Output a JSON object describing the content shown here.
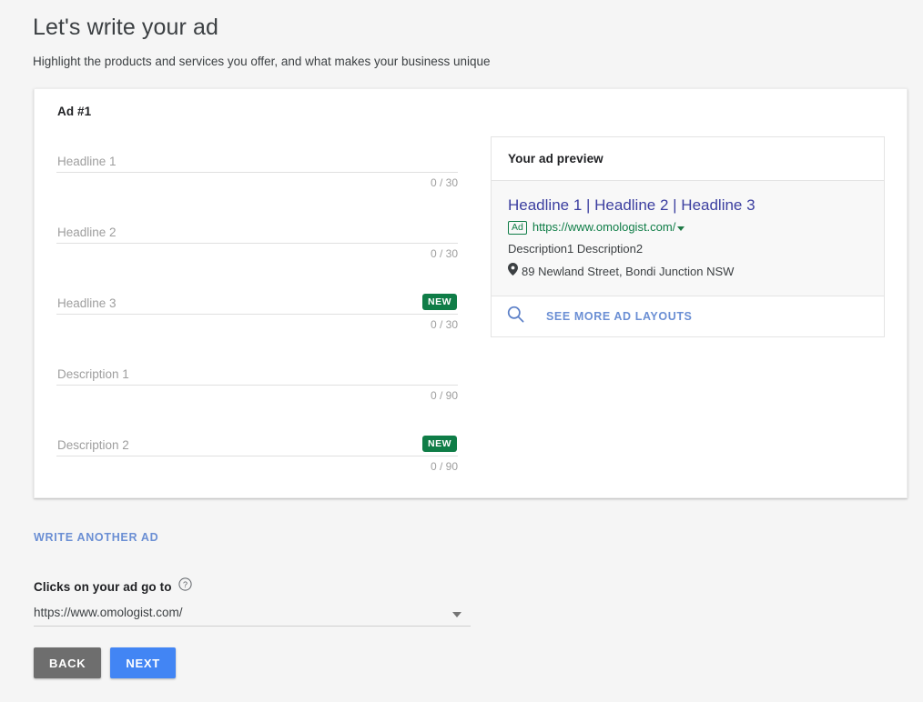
{
  "page": {
    "title": "Let's write your ad",
    "subtitle": "Highlight the products and services you offer, and what makes your business unique"
  },
  "ad_card": {
    "title": "Ad #1",
    "fields": [
      {
        "label": "Headline 1",
        "counter": "0 / 30",
        "badge": ""
      },
      {
        "label": "Headline 2",
        "counter": "0 / 30",
        "badge": ""
      },
      {
        "label": "Headline 3",
        "counter": "0 / 30",
        "badge": "NEW"
      },
      {
        "label": "Description 1",
        "counter": "0 / 90",
        "badge": ""
      },
      {
        "label": "Description 2",
        "counter": "0 / 90",
        "badge": "NEW"
      }
    ]
  },
  "preview": {
    "header_title": "Your ad preview",
    "headline": "Headline 1 | Headline 2 | Headline 3",
    "ad_chip": "Ad",
    "url": "https://www.omologist.com/",
    "description": "Description1 Description2",
    "location": "89 Newland Street, Bondi Junction NSW",
    "see_more_label": "SEE MORE AD LAYOUTS"
  },
  "actions": {
    "write_another_ad": "WRITE ANOTHER AD",
    "clicks_label": "Clicks on your ad go to",
    "final_url_value": "https://www.omologist.com/",
    "back_label": "BACK",
    "next_label": "NEXT"
  },
  "colors": {
    "page_background": "#f5f5f5",
    "accent_blue": "#4285f4",
    "link_blue": "#6b8fd4",
    "badge_green": "#0f7d47",
    "headline_indigo": "#3c3fa0",
    "back_gray": "#6e6e6e"
  }
}
